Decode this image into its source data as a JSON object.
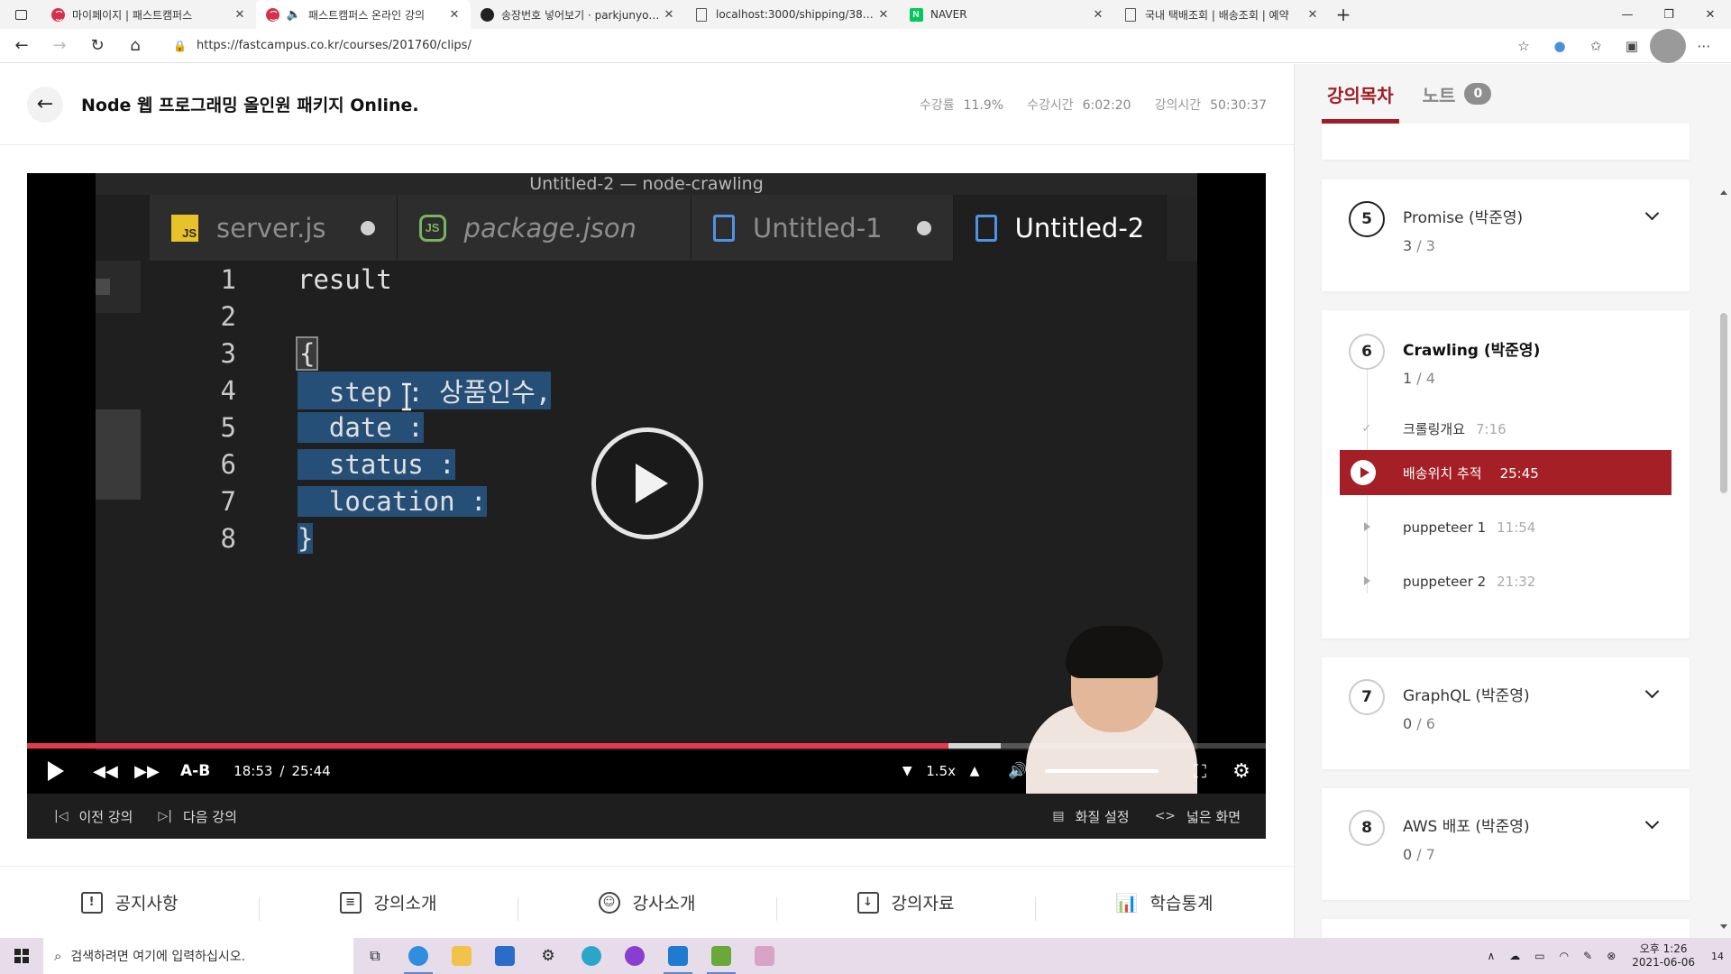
{
  "browser": {
    "tabs": [
      {
        "title": "마이페이지 | 패스트캠퍼스",
        "icon": "fastcampus-favicon"
      },
      {
        "title": "패스트캠퍼스 온라인 강의",
        "icon": "fastcampus-favicon",
        "active": true
      },
      {
        "title": "송장번호 넣어보기 · parkjunyoung",
        "icon": "github-favicon"
      },
      {
        "title": "localhost:3000/shipping/386703",
        "icon": "page-favicon"
      },
      {
        "title": "NAVER",
        "icon": "naver-favicon"
      },
      {
        "title": "국내 택배조회 | 배송조회 | 예약",
        "icon": "page-favicon"
      }
    ],
    "url": "https://fastcampus.co.kr/courses/201760/clips/"
  },
  "header": {
    "title": "Node 웹 프로그래밍 올인원 패키지 Online.",
    "stats": [
      {
        "label": "수강률",
        "value": "11.9%"
      },
      {
        "label": "수강시간",
        "value": "6:02:20"
      },
      {
        "label": "강의시간",
        "value": "50:30:37"
      }
    ]
  },
  "video": {
    "editor_title": "Untitled-2 — node-crawling",
    "editor_tabs": [
      {
        "name": "server.js",
        "icon": "js-file-icon",
        "modified": true
      },
      {
        "name": "package.json",
        "icon": "nodejs-icon",
        "italic": true
      },
      {
        "name": "Untitled-1",
        "icon": "file-icon",
        "modified": true
      },
      {
        "name": "Untitled-2",
        "icon": "file-icon",
        "current": true
      }
    ],
    "code_lines": [
      {
        "n": "1",
        "text": "result"
      },
      {
        "n": "2",
        "text": ""
      },
      {
        "n": "3",
        "text": "{"
      },
      {
        "n": "4",
        "text": "  step : 상품인수,"
      },
      {
        "n": "5",
        "text": "  date :"
      },
      {
        "n": "6",
        "text": "  status :"
      },
      {
        "n": "7",
        "text": "  location :"
      },
      {
        "n": "8",
        "text": "}"
      }
    ],
    "progress": 0.7435,
    "buffered": 0.786,
    "current_time": "18:53",
    "separator": "/",
    "duration": "25:44",
    "ab_label": "A-B",
    "rate": "1.5x",
    "volume": 1.0,
    "prev_label": "이전 강의",
    "next_label": "다음 강의",
    "quality_label": "화질 설정",
    "wide_label": "넓은 화면"
  },
  "bottom_tabs": [
    {
      "label": "공지사항",
      "icon": "notice-icon"
    },
    {
      "label": "강의소개",
      "icon": "clipboard-icon"
    },
    {
      "label": "강사소개",
      "icon": "user-icon"
    },
    {
      "label": "강의자료",
      "icon": "download-icon"
    },
    {
      "label": "학습통계",
      "icon": "chart-icon"
    }
  ],
  "panel": {
    "tabs": [
      {
        "label": "강의목차",
        "active": true
      },
      {
        "label": "노트",
        "badge": "0"
      }
    ],
    "sections": [
      {
        "num": "5",
        "title": "Promise (박준영)",
        "done": "3",
        "total": "3"
      },
      {
        "num": "6",
        "title": "Crawling (박준영)",
        "done": "1",
        "total": "4",
        "expanded": true,
        "clips": [
          {
            "name": "크롤링개요",
            "duration": "7:16",
            "state": "done"
          },
          {
            "name": "배송위치 추적",
            "duration": "25:45",
            "state": "playing"
          },
          {
            "name": "puppeteer 1",
            "duration": "11:54",
            "state": "todo"
          },
          {
            "name": "puppeteer 2",
            "duration": "21:32",
            "state": "todo"
          }
        ]
      },
      {
        "num": "7",
        "title": "GraphQL (박준영)",
        "done": "0",
        "total": "6"
      },
      {
        "num": "8",
        "title": "AWS 배포 (박준영)",
        "done": "0",
        "total": "7"
      }
    ]
  },
  "taskbar": {
    "search_placeholder": "검색하려면 여기에 입력하십시오.",
    "time": "오후 1:26",
    "date": "2021-06-06",
    "notifications": "14"
  },
  "colors": {
    "accent": "#a51f27",
    "progress": "#e53a4e",
    "selection": "#264f78"
  }
}
